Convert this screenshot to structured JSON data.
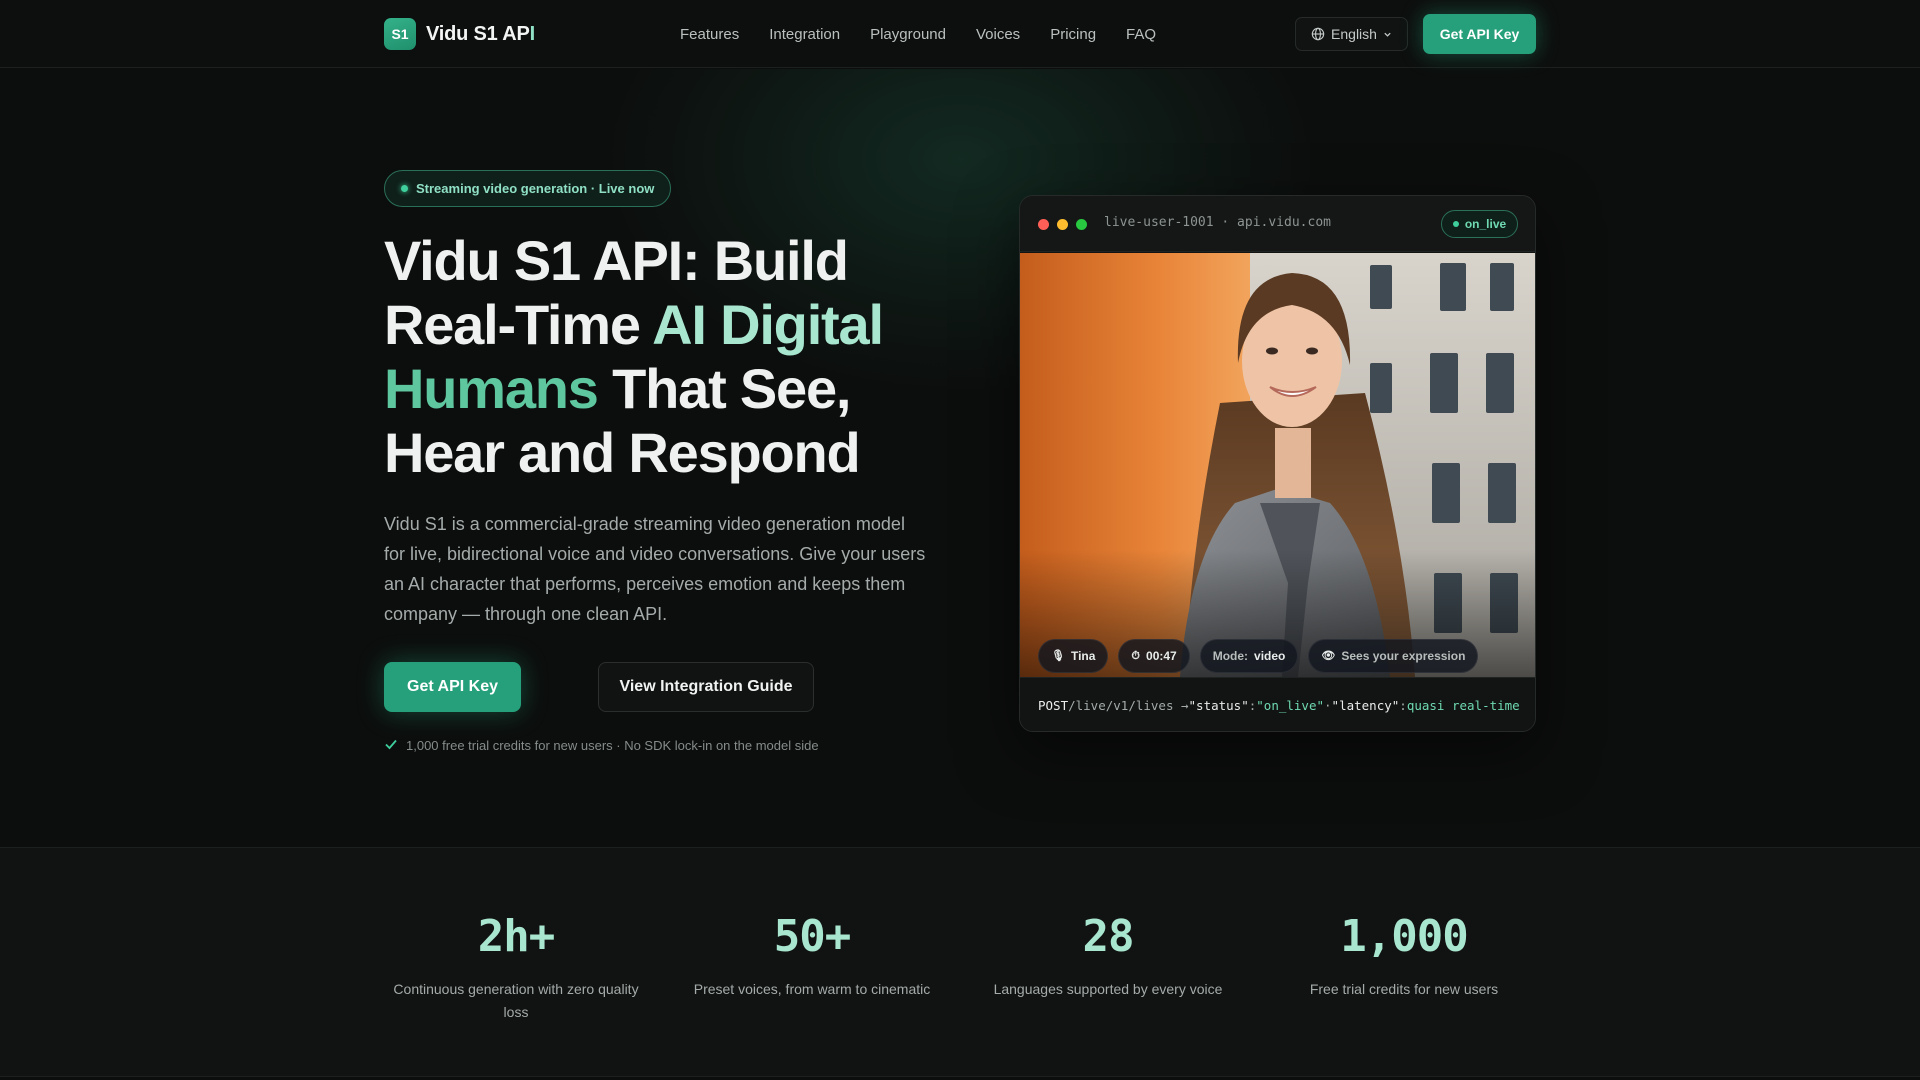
{
  "nav": {
    "brand_logo": "S1",
    "brand_name_main": "Vidu S1 AP",
    "brand_name_accent": "I",
    "links": [
      "Features",
      "Integration",
      "Playground",
      "Voices",
      "Pricing",
      "FAQ"
    ],
    "language": "English",
    "cta": "Get API Key"
  },
  "hero": {
    "pill": "Streaming video generation · Live now",
    "headline": {
      "l1": "Vidu S1 API: Build",
      "l2_a": "Real-Time ",
      "l2_b": "AI Digital",
      "l3_a": "Humans",
      "l3_b": " That See,",
      "l4": "Hear and Respond"
    },
    "description": "Vidu S1 is a commercial-grade streaming video generation model for live, bidirectional voice and video conversations. Give your users an AI character that performs, perceives emotion and keeps them company — through one clean API.",
    "primary_button": "Get API Key",
    "secondary_button": "View Integration Guide",
    "note": "1,000 free trial credits for new users · No SDK lock-in on the model side"
  },
  "live_card": {
    "host": "live-user-1001 · api.vidu.com",
    "badge": "on_live",
    "chips": {
      "name": "Tina",
      "timer": "00:47",
      "mode_label": "Mode:",
      "mode_value": "video",
      "perception": "Sees your expression"
    },
    "code": {
      "method": "POST",
      "path": " /live/v1/lives → ",
      "k1": "\"status\"",
      "sep1": ": ",
      "v1": "\"on_live\"",
      "sep2": " · ",
      "k2": "\"latency\"",
      "sep3": ": ",
      "v2": "quasi real-time"
    }
  },
  "stats": [
    {
      "value": "2h+",
      "label": "Continuous generation with zero quality loss"
    },
    {
      "value": "50+",
      "label": "Preset voices, from warm to cinematic"
    },
    {
      "value": "28",
      "label": "Languages supported by every voice"
    },
    {
      "value": "1,000",
      "label": "Free trial credits for new users"
    }
  ],
  "colors": {
    "background": "#0c0e0d",
    "accent": "#25a07a",
    "accent_light": "#a8e6cf"
  }
}
